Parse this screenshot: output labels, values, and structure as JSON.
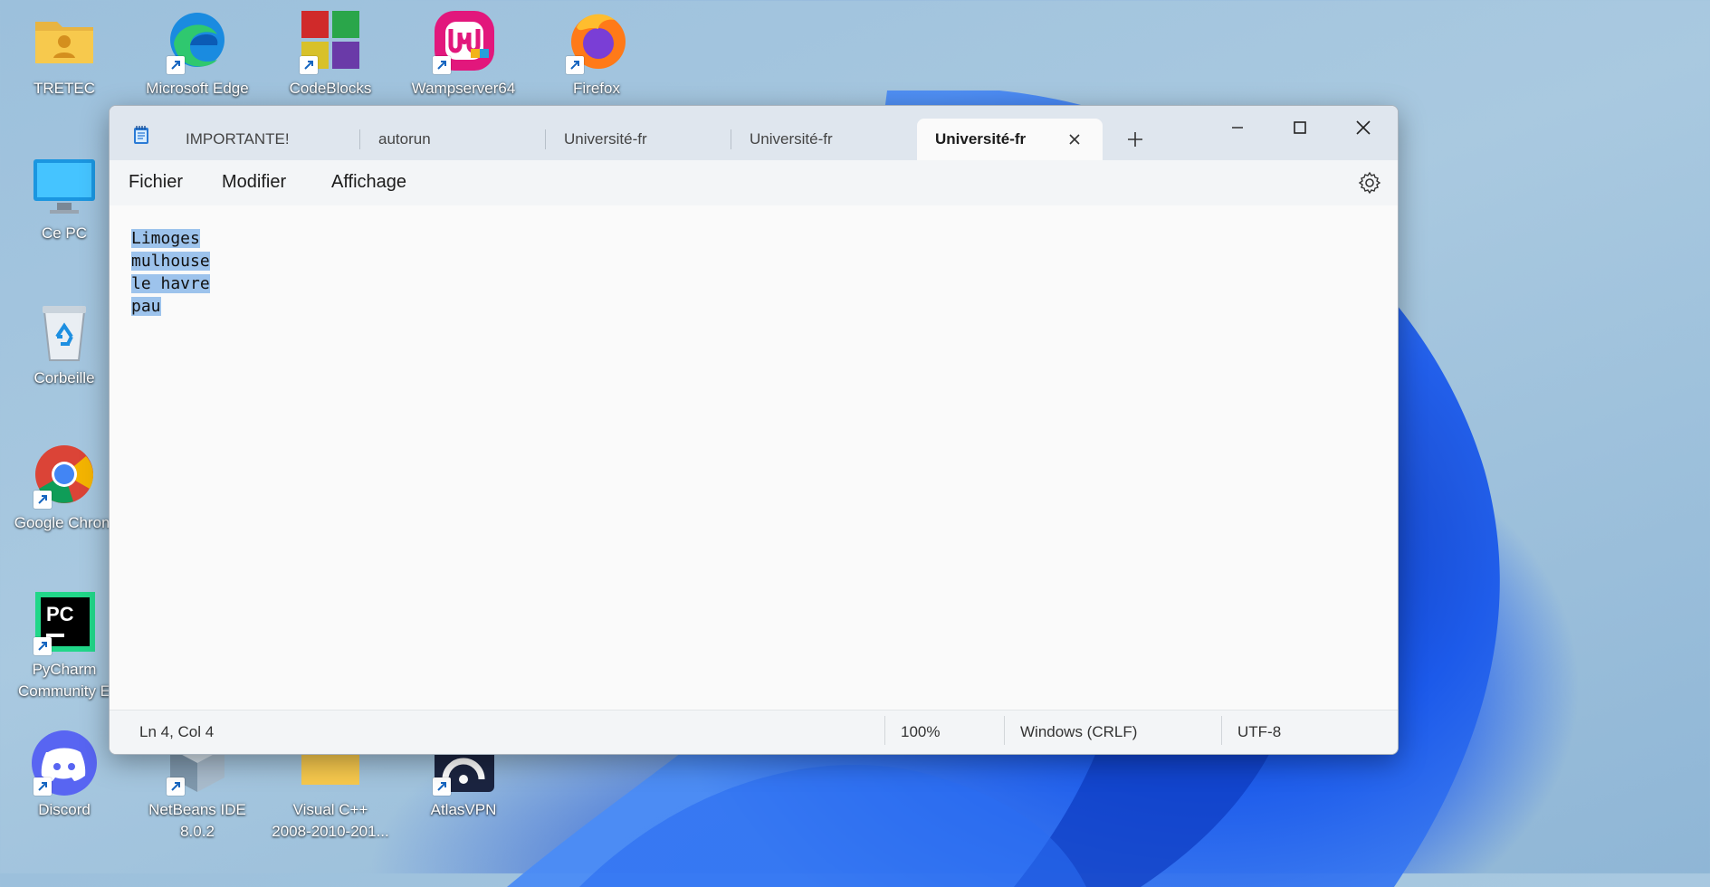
{
  "desktop": {
    "icons": [
      {
        "label": "TRETEC",
        "icon": "folder-user-icon"
      },
      {
        "label": "Microsoft Edge",
        "icon": "edge-icon"
      },
      {
        "label": "CodeBlocks",
        "icon": "codeblocks-icon"
      },
      {
        "label": "Wampserver64",
        "icon": "wampserver-icon"
      },
      {
        "label": "Firefox",
        "icon": "firefox-icon"
      },
      {
        "label": "Ce PC",
        "icon": "monitor-icon"
      },
      {
        "label": "Corbeille",
        "icon": "recycle-bin-icon"
      },
      {
        "label": "Google Chrom",
        "icon": "chrome-icon"
      },
      {
        "label": "PyCharm",
        "label2": "Community E",
        "icon": "pycharm-icon"
      },
      {
        "label": "Discord",
        "icon": "discord-icon"
      },
      {
        "label": "NetBeans IDE",
        "label2": "8.0.2",
        "icon": "netbeans-icon"
      },
      {
        "label": "Visual C++",
        "label2": "2008-2010-201...",
        "icon": "folder-icon"
      },
      {
        "label": "AtlasVPN",
        "icon": "atlasvpn-icon"
      }
    ]
  },
  "window": {
    "tabs": [
      {
        "label": "IMPORTANTE!"
      },
      {
        "label": "autorun"
      },
      {
        "label": "Université-fr"
      },
      {
        "label": "Université-fr"
      },
      {
        "label": "Université-fr",
        "active": true
      }
    ],
    "menu": {
      "file": "Fichier",
      "edit": "Modifier",
      "view": "Affichage"
    },
    "editor": {
      "lines": [
        "Limoges ",
        "mulhouse ",
        "le havre ",
        "pau"
      ]
    },
    "status": {
      "position": "Ln 4, Col 4",
      "zoom": "100%",
      "line_ending": "Windows (CRLF)",
      "encoding": "UTF-8"
    }
  },
  "colors": {
    "selection": "#9dc3ec",
    "titlebar": "#dfe6ee",
    "wallpaper_accent": "#1d5cf0"
  }
}
